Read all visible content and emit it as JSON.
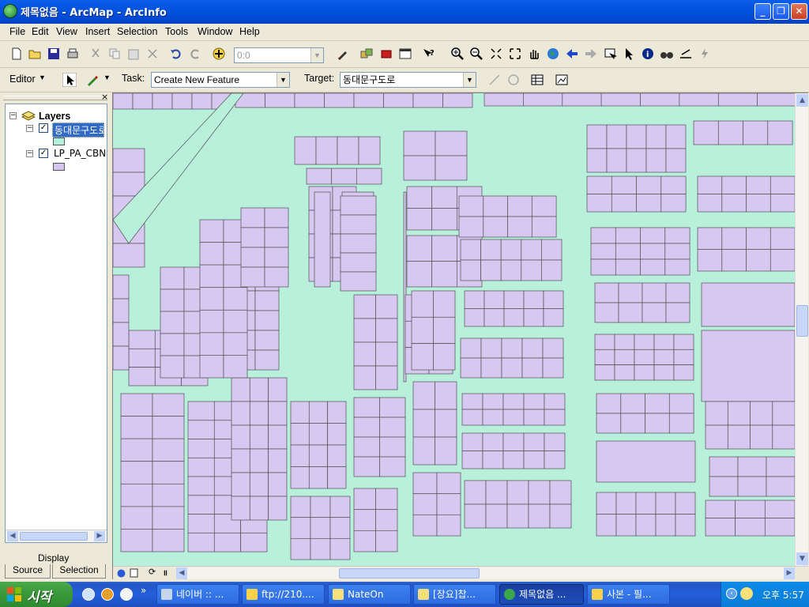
{
  "window": {
    "title": "제목없음 - ArcMap - ArcInfo"
  },
  "menu": [
    "File",
    "Edit",
    "View",
    "Insert",
    "Selection",
    "Tools",
    "Window",
    "Help"
  ],
  "standard_toolbar": {
    "scale_value": "0:0"
  },
  "editor_toolbar": {
    "editor_label": "Editor",
    "task_label": "Task:",
    "task_value": "Create New Feature",
    "target_label": "Target:",
    "target_value": "동대문구도로"
  },
  "toc": {
    "root": "Layers",
    "layers": [
      {
        "name": "동대문구도로",
        "checked": true,
        "selected": true,
        "swatch": "#b2f0dc"
      },
      {
        "name": "LP_PA_CBN",
        "checked": true,
        "selected": false,
        "swatch": "#d6c6ee"
      }
    ],
    "tabs": [
      "Display",
      "Source",
      "Selection"
    ]
  },
  "map": {
    "road_color": "#b9f0dc",
    "parcel_color": "#d7c8f2",
    "outline_color": "#505050"
  },
  "taskbar": {
    "start": "시작",
    "tasks": [
      "네이버 :: ...",
      "ftp://210....",
      "NateOn",
      "[장요]찹...",
      "제목없음 ...",
      "사본 - 필..."
    ],
    "active_task": "제목없음 ...",
    "clock": "오후 5:57"
  },
  "icons": [
    "new-icon",
    "open-icon",
    "save-icon",
    "print-icon",
    "cut-icon",
    "copy-icon",
    "paste-icon",
    "delete-icon",
    "undo-icon",
    "redo-icon",
    "add-data-icon",
    "editor-icon",
    "arctoolbox-icon",
    "command-line-icon",
    "whats-this-icon",
    "zoom-in-icon",
    "zoom-out-icon",
    "pan-icon",
    "globe-icon",
    "identify-icon"
  ]
}
